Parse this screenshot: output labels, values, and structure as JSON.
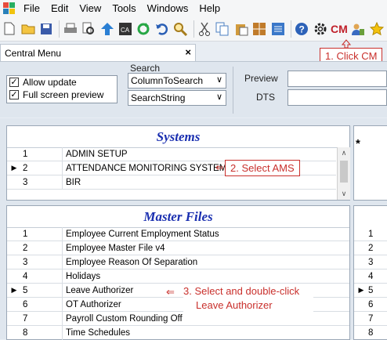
{
  "menu": [
    "File",
    "Edit",
    "View",
    "Tools",
    "Windows",
    "Help"
  ],
  "toolbar": {
    "icons": [
      "new-document-icon",
      "open-folder-icon",
      "save-icon",
      "print-icon",
      "print-preview-icon",
      "up-arrow-icon",
      "calculator-icon",
      "refresh-icon",
      "undo-icon",
      "find-icon",
      "cut-icon",
      "copy-icon",
      "paste-icon",
      "grid-icon",
      "list-icon",
      "help-icon",
      "settings-icon",
      "cm-icon",
      "user-icon",
      "star-icon"
    ],
    "cm_label": "CM"
  },
  "tab": {
    "title": "Central Menu",
    "close": "×"
  },
  "options": {
    "allow_update": "Allow update",
    "full_screen_preview": "Full screen preview"
  },
  "search": {
    "label": "Search",
    "column_value": "ColumnToSearch",
    "string_value": "SearchString"
  },
  "preview": {
    "preview_label": "Preview",
    "dts_label": "DTS"
  },
  "systems": {
    "title": "Systems",
    "rows": [
      {
        "num": "1",
        "name": "ADMIN SETUP"
      },
      {
        "num": "2",
        "name": "ATTENDANCE MONITORING SYSTEM"
      },
      {
        "num": "3",
        "name": "BIR"
      }
    ],
    "new_row_marker": "*"
  },
  "master_files": {
    "title": "Master Files",
    "rows": [
      {
        "num": "1",
        "name": "Employee Current Employment Status"
      },
      {
        "num": "2",
        "name": "Employee Master File v4"
      },
      {
        "num": "3",
        "name": "Employee Reason Of Separation"
      },
      {
        "num": "4",
        "name": "Holidays"
      },
      {
        "num": "5",
        "name": "Leave Authorizer"
      },
      {
        "num": "6",
        "name": "OT Authorizer"
      },
      {
        "num": "7",
        "name": "Payroll Custom Rounding Off"
      },
      {
        "num": "8",
        "name": "Time Schedules"
      }
    ],
    "right_nums": [
      "1",
      "2",
      "3",
      "4",
      "5",
      "6",
      "7",
      "8"
    ]
  },
  "annotations": {
    "step1": "1. Click CM",
    "step2": "2. Select AMS",
    "step3_line1": "3. Select and double-click",
    "step3_line2": "Leave Authorizer"
  },
  "colors": {
    "accent": "#c9302c",
    "section_title": "#1a2fb0"
  }
}
